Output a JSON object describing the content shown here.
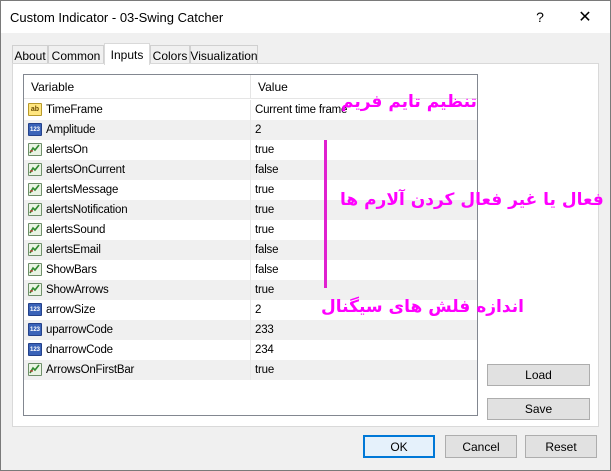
{
  "window": {
    "title": "Custom Indicator - 03-Swing Catcher",
    "help_label": "?",
    "close_label": "✕"
  },
  "tabs": [
    {
      "label": "About"
    },
    {
      "label": "Common"
    },
    {
      "label": "Inputs"
    },
    {
      "label": "Colors"
    },
    {
      "label": "Visualization"
    }
  ],
  "active_tab": "Inputs",
  "grid": {
    "headers": {
      "variable": "Variable",
      "value": "Value"
    },
    "rows": [
      {
        "name": "TimeFrame",
        "value": "Current time frame",
        "type": "string-icon"
      },
      {
        "name": "Amplitude",
        "value": "2",
        "type": "number-icon"
      },
      {
        "name": "alertsOn",
        "value": "true",
        "type": "bool-icon"
      },
      {
        "name": "alertsOnCurrent",
        "value": "false",
        "type": "bool-icon"
      },
      {
        "name": "alertsMessage",
        "value": "true",
        "type": "bool-icon"
      },
      {
        "name": "alertsNotification",
        "value": "true",
        "type": "bool-icon"
      },
      {
        "name": "alertsSound",
        "value": "true",
        "type": "bool-icon"
      },
      {
        "name": "alertsEmail",
        "value": "false",
        "type": "bool-icon"
      },
      {
        "name": "ShowBars",
        "value": "false",
        "type": "bool-icon"
      },
      {
        "name": "ShowArrows",
        "value": "true",
        "type": "bool-icon"
      },
      {
        "name": "arrowSize",
        "value": "2",
        "type": "number-icon"
      },
      {
        "name": "uparrowCode",
        "value": "233",
        "type": "number-icon"
      },
      {
        "name": "dnarrowCode",
        "value": "234",
        "type": "number-icon"
      },
      {
        "name": "ArrowsOnFirstBar",
        "value": "true",
        "type": "bool-icon"
      }
    ]
  },
  "buttons": {
    "load": "Load",
    "save": "Save",
    "ok": "OK",
    "cancel": "Cancel",
    "reset": "Reset"
  },
  "annotations": {
    "timeframe_note": "تنظیم تایم فریم",
    "alerts_note": "فعال یا غیر فعال کردن آلارم ها",
    "arrow_note": "اندازه فلش های سیگنال"
  },
  "colors": {
    "annotation": "#ff00ff",
    "accent": "#0078d7"
  },
  "icon_labels": {
    "string": "ab",
    "number": "123"
  }
}
